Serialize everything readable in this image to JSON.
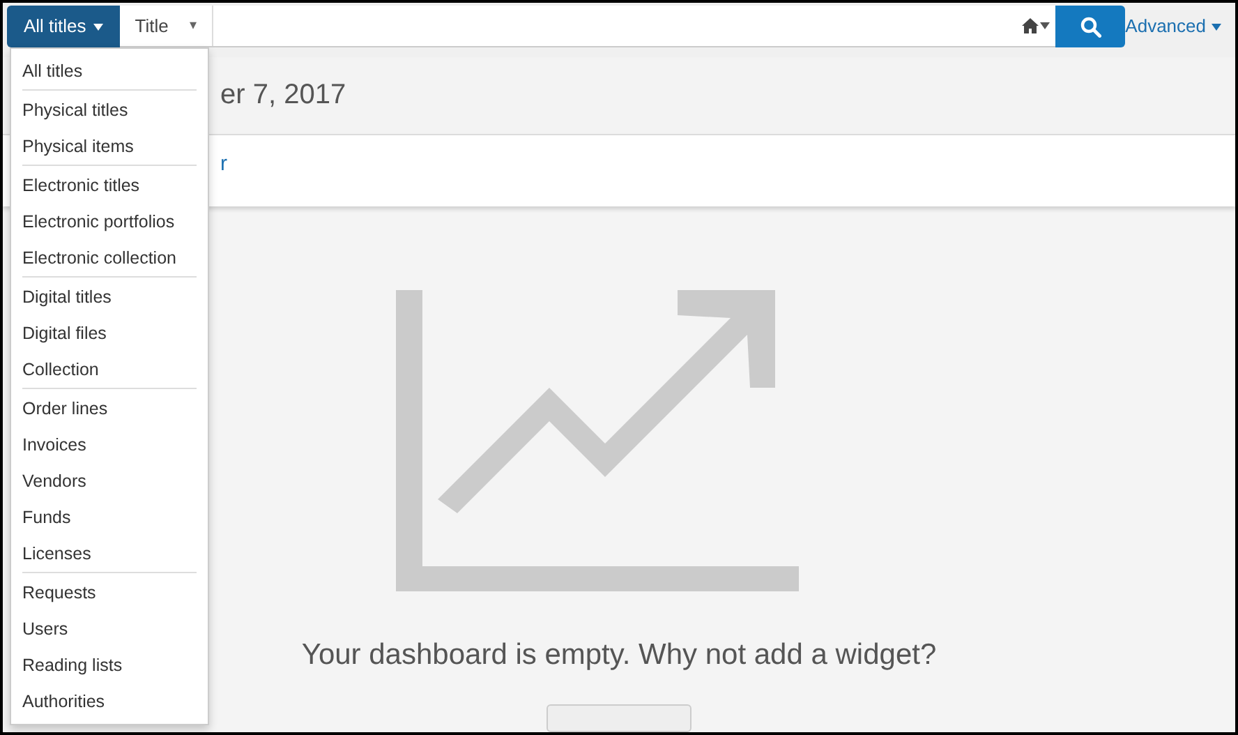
{
  "search_bar": {
    "scope_button": "All titles",
    "field_select": "Title",
    "field_arrow": "▾",
    "advanced_link": "Advanced"
  },
  "header": {
    "date_partial": "er 7, 2017",
    "link_partial": "r"
  },
  "scope_menu": {
    "groups": [
      [
        "All titles"
      ],
      [
        "Physical titles",
        "Physical items"
      ],
      [
        "Electronic titles",
        "Electronic portfolios",
        "Electronic collection"
      ],
      [
        "Digital titles",
        "Digital files",
        "Collection"
      ],
      [
        "Order lines",
        "Invoices",
        "Vendors",
        "Funds",
        "Licenses"
      ],
      [
        "Requests",
        "Users",
        "Reading lists",
        "Authorities"
      ]
    ]
  },
  "dashboard": {
    "empty_message": "Your dashboard is empty. Why not add a widget?"
  }
}
